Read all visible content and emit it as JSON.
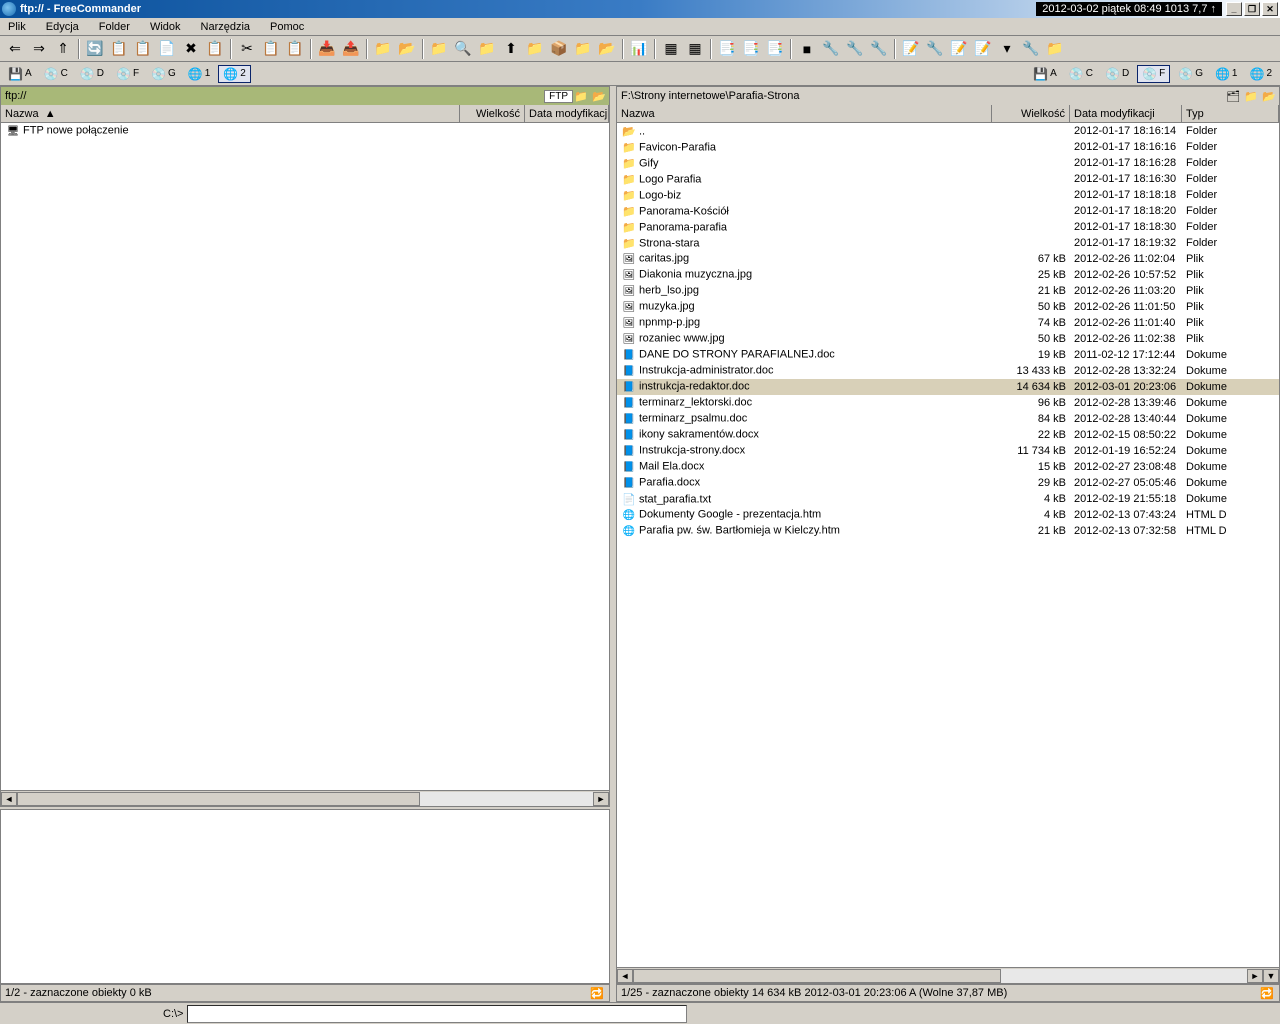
{
  "titlebar": {
    "title": "ftp:// - FreeCommander",
    "datetime": "2012-03-02 piątek 08:49  1013  7,7 ↑"
  },
  "menu": [
    "Plik",
    "Edycja",
    "Folder",
    "Widok",
    "Narzędzia",
    "Pomoc"
  ],
  "toolbar_icons": [
    "⇐",
    "⇒",
    "⇑",
    "",
    "🔄",
    "📋",
    "📋",
    "📄",
    "✖",
    "📋",
    "",
    "✂",
    "📋",
    "📋",
    "",
    "📥",
    "📤",
    "",
    "📁",
    "📂",
    "",
    "📁",
    "🔍",
    "📁",
    "⬆",
    "📁",
    "📦",
    "📁",
    "📂",
    "",
    "📊",
    "",
    "▦",
    "▦",
    "",
    "📑",
    "📑",
    "📑",
    "",
    "■",
    "🔧",
    "🔧",
    "🔧",
    "",
    "📝",
    "🔧",
    "📝",
    "📝",
    "▾",
    "🔧",
    "📁"
  ],
  "drives_left": [
    "A",
    "C",
    "D",
    "F",
    "G",
    "1",
    "2"
  ],
  "drives_right": [
    "A",
    "C",
    "D",
    "F",
    "G",
    "1",
    "2"
  ],
  "left": {
    "path": "ftp://",
    "ftptag": "FTP",
    "cols": {
      "name": "Nazwa",
      "sort": "▲",
      "size": "Wielkość",
      "date": "Data modyfikacji"
    },
    "rows": [
      {
        "icon": "ftp",
        "name": "FTP nowe połączenie",
        "size": "",
        "date": ""
      }
    ],
    "status": "1/2 - zaznaczone obiekty   0 kB"
  },
  "right": {
    "path": "F:\\Strony internetowe\\Parafia-Strona",
    "cols": {
      "name": "Nazwa",
      "size": "Wielkość",
      "date": "Data modyfikacji",
      "type": "Typ"
    },
    "rows": [
      {
        "icon": "up",
        "name": "..",
        "size": "",
        "date": "2012-01-17 18:16:14",
        "type": "Folder"
      },
      {
        "icon": "folder",
        "name": "Favicon-Parafia",
        "size": "",
        "date": "2012-01-17 18:16:16",
        "type": "Folder"
      },
      {
        "icon": "folder",
        "name": "Gify",
        "size": "",
        "date": "2012-01-17 18:16:28",
        "type": "Folder"
      },
      {
        "icon": "folder",
        "name": "Logo Parafia",
        "size": "",
        "date": "2012-01-17 18:16:30",
        "type": "Folder"
      },
      {
        "icon": "folder",
        "name": "Logo-biz",
        "size": "",
        "date": "2012-01-17 18:18:18",
        "type": "Folder"
      },
      {
        "icon": "folder",
        "name": "Panorama-Kościół",
        "size": "",
        "date": "2012-01-17 18:18:20",
        "type": "Folder"
      },
      {
        "icon": "folder",
        "name": "Panorama-parafia",
        "size": "",
        "date": "2012-01-17 18:18:30",
        "type": "Folder"
      },
      {
        "icon": "folder",
        "name": "Strona-stara",
        "size": "",
        "date": "2012-01-17 18:19:32",
        "type": "Folder"
      },
      {
        "icon": "img",
        "name": "caritas.jpg",
        "size": "67 kB",
        "date": "2012-02-26 11:02:04",
        "type": "Plik"
      },
      {
        "icon": "img",
        "name": "Diakonia muzyczna.jpg",
        "size": "25 kB",
        "date": "2012-02-26 10:57:52",
        "type": "Plik"
      },
      {
        "icon": "img",
        "name": "herb_lso.jpg",
        "size": "21 kB",
        "date": "2012-02-26 11:03:20",
        "type": "Plik"
      },
      {
        "icon": "img",
        "name": "muzyka.jpg",
        "size": "50 kB",
        "date": "2012-02-26 11:01:50",
        "type": "Plik"
      },
      {
        "icon": "img",
        "name": "npnmp-p.jpg",
        "size": "74 kB",
        "date": "2012-02-26 11:01:40",
        "type": "Plik"
      },
      {
        "icon": "img",
        "name": "rozaniec www.jpg",
        "size": "50 kB",
        "date": "2012-02-26 11:02:38",
        "type": "Plik"
      },
      {
        "icon": "doc",
        "name": "DANE DO STRONY PARAFIALNEJ.doc",
        "size": "19 kB",
        "date": "2011-02-12 17:12:44",
        "type": "Dokume"
      },
      {
        "icon": "doc",
        "name": "Instrukcja-administrator.doc",
        "size": "13 433 kB",
        "date": "2012-02-28 13:32:24",
        "type": "Dokume"
      },
      {
        "icon": "doc",
        "name": "instrukcja-redaktor.doc",
        "size": "14 634 kB",
        "date": "2012-03-01 20:23:06",
        "type": "Dokume",
        "selected": true
      },
      {
        "icon": "doc",
        "name": "terminarz_lektorski.doc",
        "size": "96 kB",
        "date": "2012-02-28 13:39:46",
        "type": "Dokume"
      },
      {
        "icon": "doc",
        "name": "terminarz_psalmu.doc",
        "size": "84 kB",
        "date": "2012-02-28 13:40:44",
        "type": "Dokume"
      },
      {
        "icon": "doc",
        "name": "ikony sakramentów.docx",
        "size": "22 kB",
        "date": "2012-02-15 08:50:22",
        "type": "Dokume"
      },
      {
        "icon": "doc",
        "name": "Instrukcja-strony.docx",
        "size": "11 734 kB",
        "date": "2012-01-19 16:52:24",
        "type": "Dokume"
      },
      {
        "icon": "doc",
        "name": "Mail Ela.docx",
        "size": "15 kB",
        "date": "2012-02-27 23:08:48",
        "type": "Dokume"
      },
      {
        "icon": "doc",
        "name": "Parafia.docx",
        "size": "29 kB",
        "date": "2012-02-27 05:05:46",
        "type": "Dokume"
      },
      {
        "icon": "file",
        "name": "stat_parafia.txt",
        "size": "4 kB",
        "date": "2012-02-19 21:55:18",
        "type": "Dokume"
      },
      {
        "icon": "htm",
        "name": "Dokumenty Google - prezentacja.htm",
        "size": "4 kB",
        "date": "2012-02-13 07:43:24",
        "type": "HTML D"
      },
      {
        "icon": "htm",
        "name": "Parafia pw. św. Bartłomieja w Kielczy.htm",
        "size": "21 kB",
        "date": "2012-02-13 07:32:58",
        "type": "HTML D"
      }
    ],
    "status": "1/25 - zaznaczone obiekty   14 634 kB  2012-03-01 20:23:06  A   (Wolne 37,87 MB)"
  },
  "cmdprompt": "C:\\>"
}
